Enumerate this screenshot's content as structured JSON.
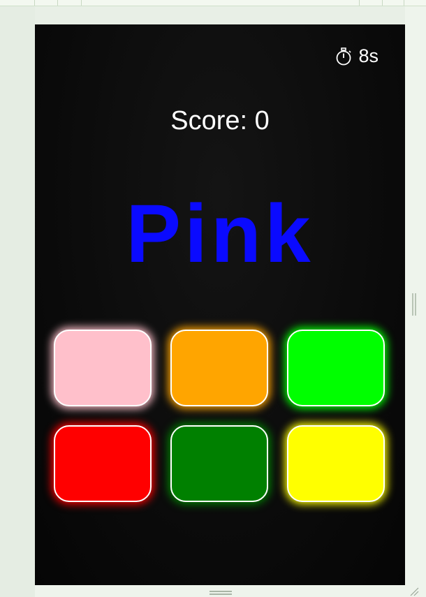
{
  "timer": {
    "icon": "stopwatch-icon",
    "text": "8s"
  },
  "score": {
    "text": "Score: 0"
  },
  "target": {
    "word": "Pink",
    "color": "#0a0aff"
  },
  "tiles": [
    {
      "name": "pink",
      "color": "#ffc0cb"
    },
    {
      "name": "orange",
      "color": "#ffa500"
    },
    {
      "name": "lime",
      "color": "#00ff00"
    },
    {
      "name": "red",
      "color": "#ff0000"
    },
    {
      "name": "green",
      "color": "#008000"
    },
    {
      "name": "yellow",
      "color": "#ffff00"
    }
  ]
}
